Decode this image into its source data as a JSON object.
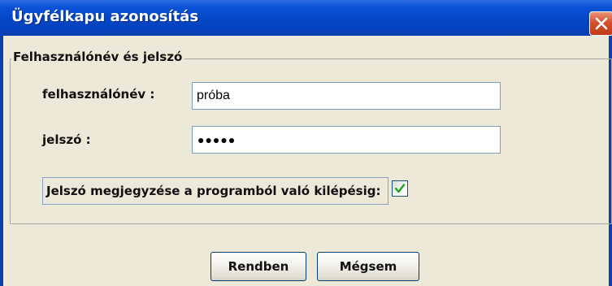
{
  "window": {
    "title": "Ügyfélkapu azonosítás",
    "close_icon": "close-icon"
  },
  "group": {
    "legend": "Felhasználónév és jelszó"
  },
  "username": {
    "label": "felhasználónév :",
    "value": "próba"
  },
  "password": {
    "label": "jelszó :",
    "masked_value": "●●●●●"
  },
  "remember": {
    "label": "Jelszó megjegyzése a programból való kilépésig:",
    "checked": true
  },
  "buttons": {
    "ok_label": "Rendben",
    "cancel_label": "Mégsem"
  },
  "colors": {
    "titlebar": "#0346C4",
    "dialog_background": "#ECE9D8",
    "close_button": "#D4502C",
    "field_border": "#7F9DB9"
  }
}
